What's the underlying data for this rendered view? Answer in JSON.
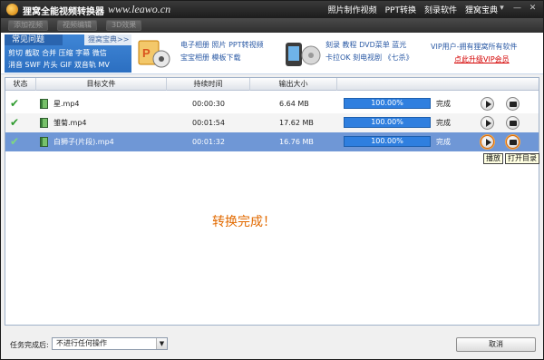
{
  "app": {
    "title": "狸窝全能视频转换器",
    "site": "www.leawo.cn"
  },
  "top_menu": [
    "照片制作视频",
    "PPT转换",
    "刻录软件",
    "狸窝宝典"
  ],
  "window_controls": [
    "▾",
    "—",
    "✕"
  ],
  "toolbar": [
    "添加视频",
    "视频编辑",
    "3D效果"
  ],
  "faq": {
    "tab": "常见问题",
    "more": "狸窝宝典>>",
    "line1": "剪切 截取 合并 压缩 字幕 微信",
    "line2": "消音 SWF 片头 GIF 双音轨 MV"
  },
  "promo1": {
    "line1": "电子相册 照片 PPT转视频",
    "line2": "宝宝相册 模板下载"
  },
  "promo2": {
    "line1": "刻录 教程 DVD菜单 蓝光",
    "line2": "卡拉OK 刻电视剧 《七杀》"
  },
  "vip": {
    "text": "VIP用户-拥有狸窝所有软件",
    "link": "点此升级VIP会员"
  },
  "table": {
    "headers": [
      "状态",
      "目标文件",
      "持续时间",
      "输出大小"
    ],
    "rows": [
      {
        "status": "✔",
        "file": "星.mp4",
        "duration": "00:00:30",
        "size": "6.64 MB",
        "progress": "100.00%",
        "progress_value": 100,
        "state": "完成"
      },
      {
        "status": "✔",
        "file": "雏菊.mp4",
        "duration": "00:01:54",
        "size": "17.62 MB",
        "progress": "100.00%",
        "progress_value": 100,
        "state": "完成"
      },
      {
        "status": "✔",
        "file": "白狮子(片段).mp4",
        "duration": "00:01:32",
        "size": "16.76 MB",
        "progress": "100.00%",
        "progress_value": 100,
        "state": "完成"
      }
    ]
  },
  "tooltips": {
    "play": "播放",
    "open_folder": "打开目录"
  },
  "done_message": "转换完成！",
  "footer": {
    "label": "任务完成后:",
    "select_value": "不进行任何操作",
    "cancel": "取消"
  }
}
